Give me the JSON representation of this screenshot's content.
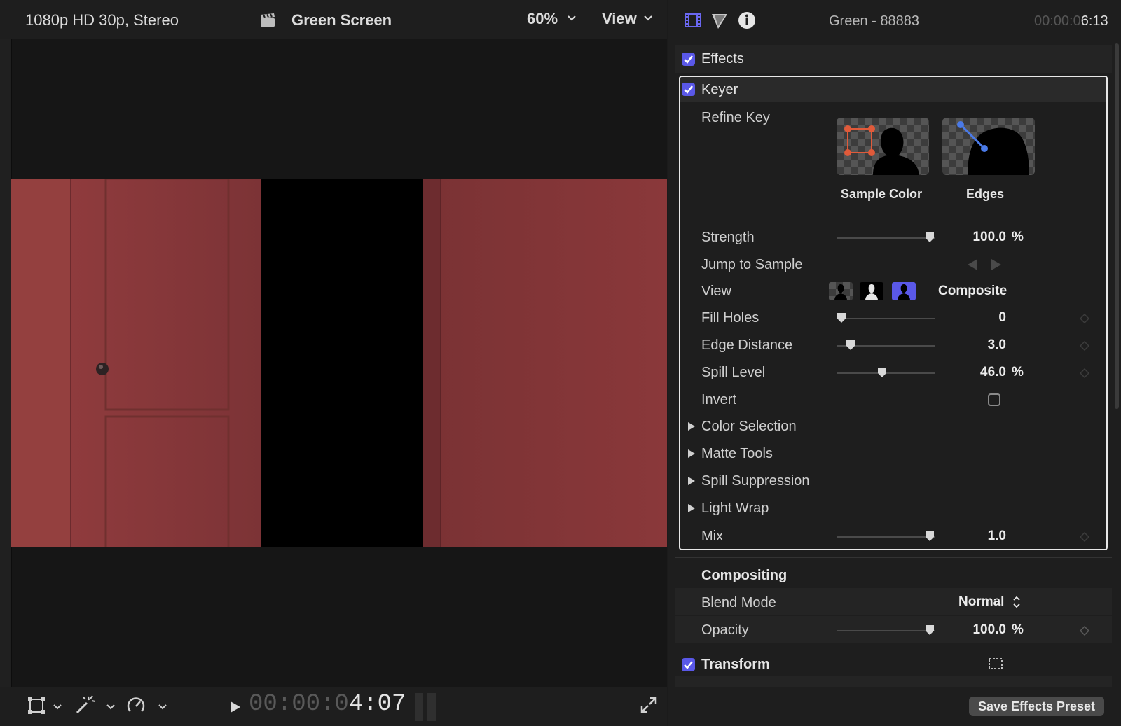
{
  "viewer": {
    "format": "1080p HD 30p, Stereo",
    "clip_name": "Green Screen",
    "zoom": "60%",
    "view_menu": "View",
    "timecode_dim": "00:00:0",
    "timecode_lit": "4:07"
  },
  "inspector": {
    "title": "Green - 88883",
    "timecode_dim": "00:00:0",
    "timecode_lit": "6:13",
    "effects_label": "Effects",
    "keyer": {
      "label": "Keyer",
      "refine_key_label": "Refine Key",
      "sample_color_label": "Sample Color",
      "edges_label": "Edges",
      "strength": {
        "label": "Strength",
        "value": "100.0",
        "unit": "%",
        "level": 1.0
      },
      "jump_to_sample_label": "Jump to Sample",
      "view": {
        "label": "View",
        "value": "Composite"
      },
      "fill_holes": {
        "label": "Fill Holes",
        "value": "0",
        "level": 0.0
      },
      "edge_distance": {
        "label": "Edge Distance",
        "value": "3.0",
        "level": 0.1
      },
      "spill_level": {
        "label": "Spill Level",
        "value": "46.0",
        "unit": "%",
        "level": 0.46
      },
      "invert_label": "Invert",
      "groups": [
        "Color Selection",
        "Matte Tools",
        "Spill Suppression",
        "Light Wrap"
      ],
      "mix": {
        "label": "Mix",
        "value": "1.0",
        "level": 1.0
      }
    },
    "compositing": {
      "label": "Compositing",
      "blend_mode": {
        "label": "Blend Mode",
        "value": "Normal"
      },
      "opacity": {
        "label": "Opacity",
        "value": "100.0",
        "unit": "%",
        "level": 1.0
      }
    },
    "transform_label": "Transform",
    "save_preset_label": "Save Effects Preset"
  },
  "colors": {
    "accent": "#5a58e8",
    "wall": "#8d3a3c",
    "door": "#8f3b3d"
  }
}
